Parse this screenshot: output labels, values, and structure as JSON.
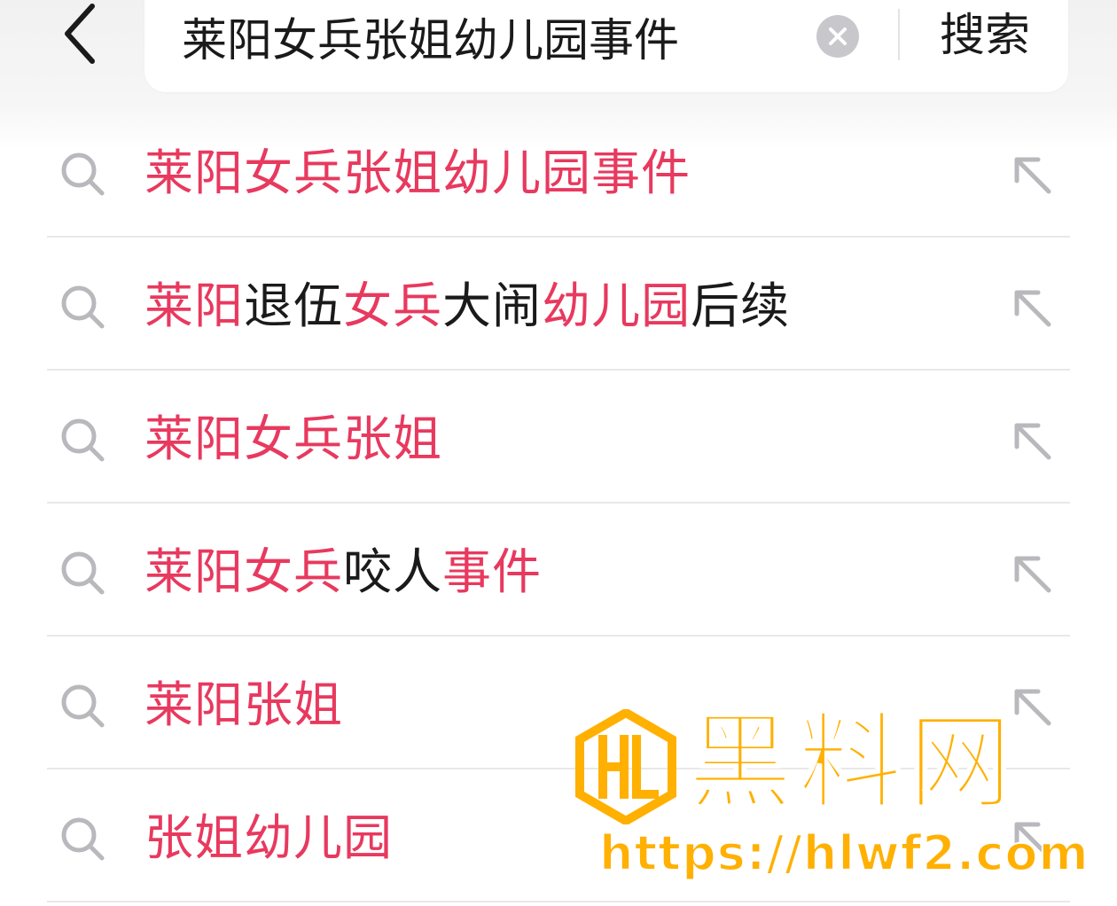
{
  "header": {
    "search_value": "莱阳女兵张姐幼儿园事件",
    "search_button_label": "搜索",
    "back_icon": "chevron-left-icon",
    "clear_icon": "clear-circle-icon"
  },
  "colors": {
    "highlight": "#e8395e",
    "normal_text": "#1a1a1a",
    "icon_gray": "#b9b9bd",
    "watermark": "#ffb000"
  },
  "suggestions": [
    {
      "segments": [
        {
          "text": "莱阳女兵张姐幼儿园事件",
          "hl": true
        }
      ]
    },
    {
      "segments": [
        {
          "text": "莱阳",
          "hl": true
        },
        {
          "text": "退伍",
          "hl": false
        },
        {
          "text": "女兵",
          "hl": true
        },
        {
          "text": "大闹",
          "hl": false
        },
        {
          "text": "幼儿园",
          "hl": true
        },
        {
          "text": "后续",
          "hl": false
        }
      ]
    },
    {
      "segments": [
        {
          "text": "莱阳女兵张姐",
          "hl": true
        }
      ]
    },
    {
      "segments": [
        {
          "text": "莱阳女兵",
          "hl": true
        },
        {
          "text": "咬人",
          "hl": false
        },
        {
          "text": "事件",
          "hl": true
        }
      ]
    },
    {
      "segments": [
        {
          "text": "莱阳张姐",
          "hl": true
        }
      ]
    },
    {
      "segments": [
        {
          "text": "张姐幼儿园",
          "hl": true
        }
      ]
    }
  ],
  "watermark": {
    "title": "黑料网",
    "url": "https://hlwf2.com"
  }
}
